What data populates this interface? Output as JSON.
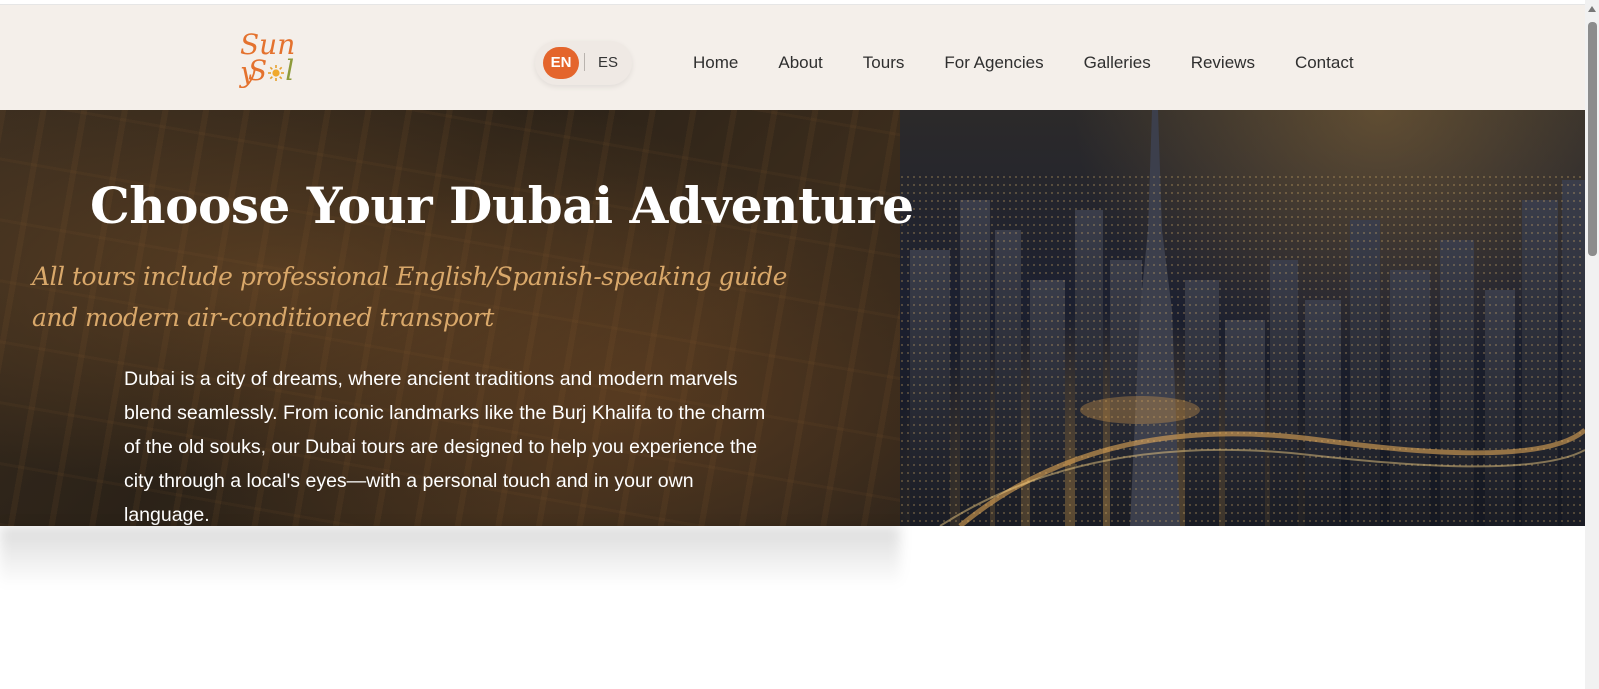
{
  "header": {
    "logo": {
      "line1": "Sun y",
      "line2_s": "S",
      "line2_l": "l"
    },
    "language": {
      "active": "EN",
      "other": "ES"
    },
    "nav": [
      "Home",
      "About",
      "Tours",
      "For Agencies",
      "Galleries",
      "Reviews",
      "Contact"
    ]
  },
  "hero": {
    "title": "Choose Your Dubai Adventure",
    "subtitle": "All tours include professional English/Spanish-speaking guide and modern air-conditioned transport",
    "description": "Dubai is a city of dreams, where ancient traditions and modern marvels blend seamlessly. From iconic landmarks like the Burj Khalifa to the charm of the old souks, our Dubai tours are designed to help you experience the city through a local's eyes—with a personal touch and in your own language."
  },
  "colors": {
    "accent": "#e4652c",
    "subtitle": "#d9a86a",
    "header_bg": "#f4eee9",
    "logo_green": "#8e9a3b"
  },
  "icons": {
    "logo_sun": "sun-icon",
    "scroll_up": "scroll-up-arrow-icon"
  }
}
